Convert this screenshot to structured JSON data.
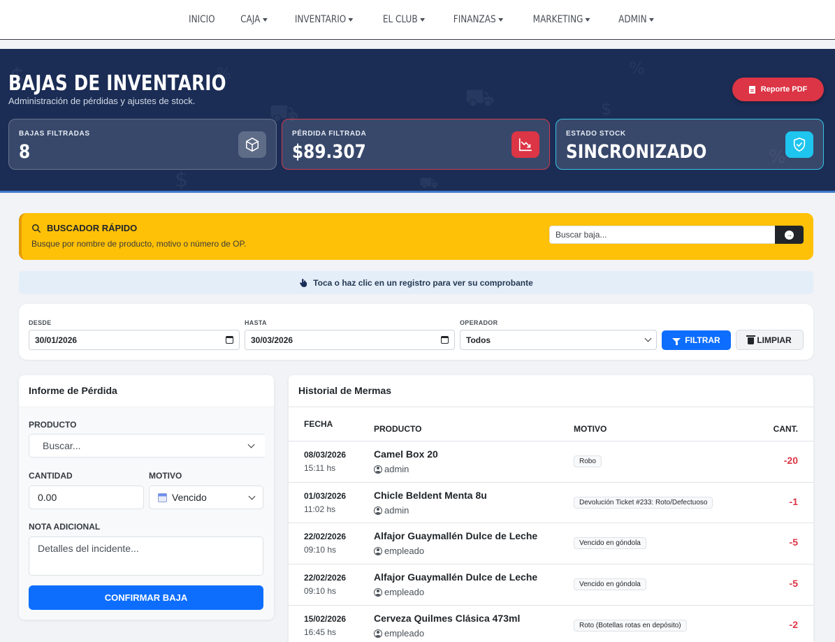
{
  "nav": {
    "items": [
      {
        "label": "INICIO",
        "dropdown": false
      },
      {
        "label": "CAJA",
        "dropdown": true
      },
      {
        "label": "INVENTARIO",
        "dropdown": true
      },
      {
        "label": "EL CLUB",
        "dropdown": true
      },
      {
        "label": "FINANZAS",
        "dropdown": true
      },
      {
        "label": "MARKETING",
        "dropdown": true
      },
      {
        "label": "ADMIN",
        "dropdown": true
      }
    ]
  },
  "hero": {
    "title": "BAJAS DE INVENTARIO",
    "subtitle": "Administración de pérdidas y ajustes de stock.",
    "pdf_button": "Reporte PDF",
    "stats": [
      {
        "label": "BAJAS FILTRADAS",
        "value": "8",
        "icon": "box-icon"
      },
      {
        "label": "PÉRDIDA FILTRADA",
        "value": "$89.307",
        "icon": "chart-down-icon"
      },
      {
        "label": "ESTADO STOCK",
        "value": "SINCRONIZADO",
        "icon": "shield-check-icon"
      }
    ]
  },
  "quick_search": {
    "title": "BUSCADOR RÁPIDO",
    "description": "Busque por nombre de producto, motivo o número de OP.",
    "placeholder": "Buscar baja..."
  },
  "hint": "Toca o haz clic en un registro para ver su comprobante",
  "filters": {
    "from_label": "DESDE",
    "from_value": "30/01/2026",
    "to_label": "HASTA",
    "to_value": "30/03/2026",
    "operator_label": "OPERADOR",
    "operator_value": "Todos",
    "filter_button": "FILTRAR",
    "clear_button": "LIMPIAR"
  },
  "loss_form": {
    "title": "Informe de Pérdida",
    "product_label": "PRODUCTO",
    "product_placeholder": "Buscar...",
    "quantity_label": "CANTIDAD",
    "quantity_value": "0.00",
    "reason_label": "MOTIVO",
    "reason_value": "Vencido",
    "note_label": "NOTA ADICIONAL",
    "note_placeholder": "Detalles del incidente...",
    "confirm_button": "CONFIRMAR BAJA"
  },
  "history": {
    "title": "Historial de Mermas",
    "columns": {
      "date": "FECHA",
      "product": "PRODUCTO",
      "reason": "MOTIVO",
      "qty": "CANT."
    },
    "rows": [
      {
        "date": "08/03/2026",
        "time": "15:11 hs",
        "product": "Camel Box 20",
        "user": "admin",
        "reason": "Robo",
        "qty": "-20"
      },
      {
        "date": "01/03/2026",
        "time": "11:02 hs",
        "product": "Chicle Beldent Menta 8u",
        "user": "admin",
        "reason": "Devolución Ticket #233: Roto/Defectuoso",
        "qty": "-1"
      },
      {
        "date": "22/02/2026",
        "time": "09:10 hs",
        "product": "Alfajor Guaymallén Dulce de Leche",
        "user": "empleado",
        "reason": "Vencido en góndola",
        "qty": "-5"
      },
      {
        "date": "22/02/2026",
        "time": "09:10 hs",
        "product": "Alfajor Guaymallén Dulce de Leche",
        "user": "empleado",
        "reason": "Vencido en góndola",
        "qty": "-5"
      },
      {
        "date": "15/02/2026",
        "time": "16:45 hs",
        "product": "Cerveza Quilmes Clásica 473ml",
        "user": "empleado",
        "reason": "Roto (Botellas rotas en depósito)",
        "qty": "-2"
      }
    ]
  },
  "colors": {
    "hero_bg": "#1b2d55",
    "accent_blue": "#0d6efd",
    "danger": "#dc3545",
    "warning": "#ffc107",
    "info": "#1ec5ee"
  }
}
